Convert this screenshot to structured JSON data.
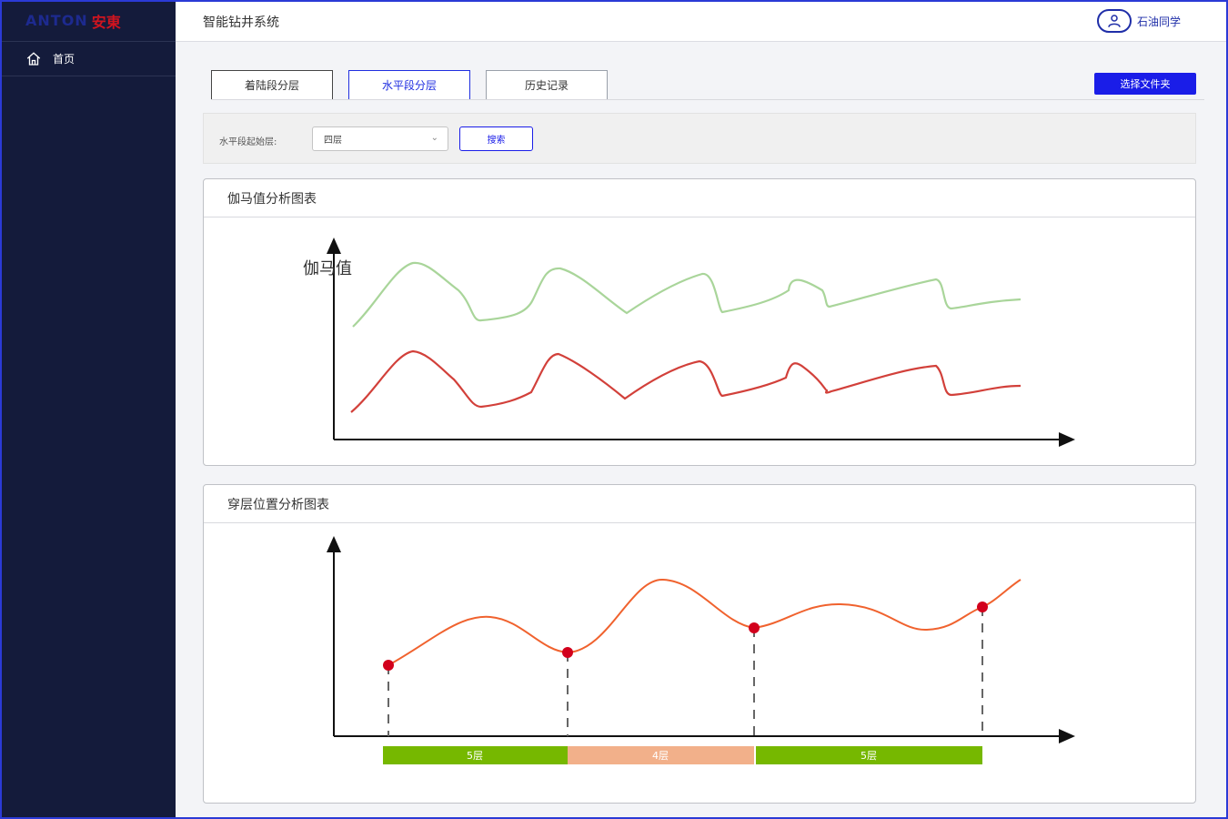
{
  "brand": {
    "logo_en": "ANTON",
    "logo_cn": "安東"
  },
  "sidebar": {
    "items": [
      {
        "label": "首页",
        "icon": "home-icon"
      }
    ]
  },
  "header": {
    "title": "智能钻井系统",
    "user_name": "石油同学",
    "user_icon": "user-icon"
  },
  "tabs": [
    {
      "label": "着陆段分层",
      "active": false
    },
    {
      "label": "水平段分层",
      "active": true
    },
    {
      "label": "历史记录",
      "active": false
    }
  ],
  "toolbar": {
    "folder_button": "选择文件夹"
  },
  "filter": {
    "label": "水平段起始层:",
    "select_value": "四层",
    "search_button": "搜索"
  },
  "gamma_panel": {
    "title": "伽马值分析图表",
    "y_axis_label": "伽马值"
  },
  "layer_panel": {
    "title": "穿层位置分析图表"
  },
  "chart_data": [
    {
      "type": "line",
      "title": "伽马值分析图表",
      "ylabel": "伽马值",
      "xlabel": "",
      "series": [
        {
          "color": "#a9d59a"
        },
        {
          "color": "#d2403a"
        }
      ],
      "grid": false
    },
    {
      "type": "line",
      "title": "穿层位置分析图表",
      "series": [
        {
          "color": "#f0622e"
        }
      ],
      "crossing_markers": 4,
      "marker_color": "#d2001c",
      "layers": [
        {
          "label": "5层",
          "color": "#76b800"
        },
        {
          "label": "4层",
          "color": "#f2b08a"
        },
        {
          "label": "5层",
          "color": "#76b800"
        }
      ],
      "grid": false
    }
  ],
  "colors": {
    "sidebar": "#141b3b",
    "accent": "#1a1de8",
    "brand_red": "#d0141f"
  }
}
